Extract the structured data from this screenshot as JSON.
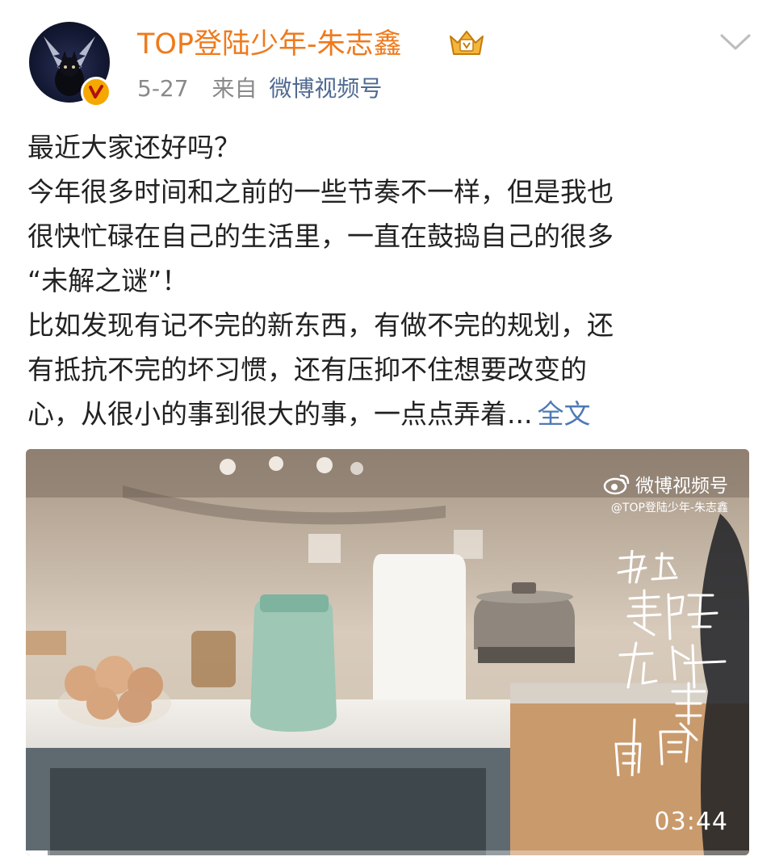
{
  "header": {
    "username": "TOP登陆少年-朱志鑫",
    "time": "5-27",
    "source_prefix": "来自",
    "source": "微博视频号",
    "vip_icon": "crown-vip-icon",
    "verified_icon": "verified-v-icon",
    "more_icon": "chevron-down-icon"
  },
  "post": {
    "lines": [
      "最近大家还好吗？",
      "今年很多时间和之前的一些节奏不一样，但是我也",
      "很快忙碌在自己的生活里，一直在鼓捣自己的很多",
      "“未解之谜”！",
      "比如发现有记不完的新东西，有做不完的规划，还",
      "有抵抗不完的坏习惯，还有压抑不住想要改变的",
      "心，从很小的事到很大的事，一点点弄着..."
    ],
    "full_text_link": "全文"
  },
  "video": {
    "watermark_brand": "微博视频号",
    "watermark_user": "@TOP登陆少年-朱志鑫",
    "duration": "03:44",
    "progress": 0.03,
    "calligraphy_text": "我想要陪在你身边的周周"
  },
  "colors": {
    "username": "#ef7a1c",
    "link": "#4f7ab5",
    "source": "#4f6a92",
    "meta": "#8a8a8a",
    "text": "#222222",
    "verified": "#f5a800"
  }
}
